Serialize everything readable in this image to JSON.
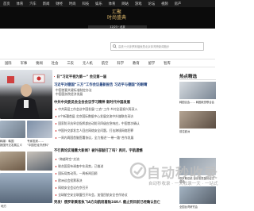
{
  "topnav": {
    "items": [
      "首页",
      "体育",
      "汽车",
      "新闻",
      "财经",
      "时尚",
      "科技",
      "娱乐",
      "体育",
      "网站",
      "游戏",
      "论坛",
      "视频",
      "房产"
    ]
  },
  "banner": {
    "logo_line1": "汇聚",
    "logo_line2": "时尚盛典",
    "strip": "12/23 · 北京"
  },
  "search": {
    "placeholder": "高铁十分钟罗斯福就是北京体育跨新闻跑步"
  },
  "catnav": {
    "items": [
      "国际",
      "军事",
      "要闻",
      "社会",
      "三农",
      "无人机",
      "航空",
      "科学",
      "教育",
      "留学",
      "智库"
    ]
  },
  "left": {
    "captions": [
      "韩媒：韩国",
      "专家发射……",
      "报国外交发展主义",
      "\"中国在经济资料\""
    ],
    "bottom_caption": "地方"
  },
  "headlines": [
    {
      "text": "日“习近平视为第一” 会见第一届",
      "style": "hl"
    },
    {
      "text": "习近平对德国“三方”工作会议最新报告 习近平与德国“的眼睛",
      "style": "hl"
    },
    {
      "text": "中国首要关键标准制定办法",
      "style": "ln"
    },
    {
      "text": "中国国务院经济发展",
      "style": "ln"
    },
    {
      "text": "中共中央委员会全会会议学习精神 新时代中国发展",
      "style": "hl"
    },
    {
      "text": "中共高层工作会议中国发展“三农”工作 乡村全面振兴再深入",
      "style": "ln"
    },
    {
      "text": "8个新疆首届 北京国际数据中心发展交流中外媒联合采访",
      "style": "ln"
    },
    {
      "text": "国家防汛抗旱总指挥部启动防汛四级应急响应，中国首次确认",
      "style": "ln"
    },
    {
      "text": "中国外交部发言人回应网络安全问题，打击跨境网络犯罪",
      "style": "ln"
    },
    {
      "text": "一周内两国首脑签署协议，全力推进“一带一路”合作发展",
      "style": "ln"
    },
    {
      "text": "不行舆论实锤重大新闻？被外部敲打了吗？再问，宇航遗憾",
      "style": "hl"
    },
    {
      "text": "“跨越时空”交流",
      "style": "ln"
    },
    {
      "text": "联合国宣布调查中东局势，已推进",
      "style": "ln"
    },
    {
      "text": "国际局势动荡，一周新闻回顾",
      "style": "ln"
    },
    {
      "text": "欧洲议会投票表决",
      "style": "ln"
    },
    {
      "text": "网络安全会议在京召开",
      "style": "ln"
    },
    {
      "text": "全球航空安全联盟召开年会，加强民航安全合作协议",
      "style": "ln"
    },
    {
      "text": "突发！俄罗斯乘客执飞A方向航班着陆240人 截止到目前已经确认伤亡",
      "style": "hl"
    }
  ],
  "right": {
    "title": "热点精选",
    "captions": [
      "韩国议会…… 韩国政党联合会",
      "前往欧洲",
      "俄罗斯总统 普京发表国情咨文讲话",
      "全国台湾研究会"
    ]
  },
  "watermark": {
    "text1": "自动秒收录",
    "text2": "自动秒收录 · 一天收录一天 · 一站式"
  },
  "colors": {
    "topbar": "#1a1a1a",
    "banner": "#0b0b0b",
    "gold": "#d9b46a",
    "accent": "#c00000"
  }
}
